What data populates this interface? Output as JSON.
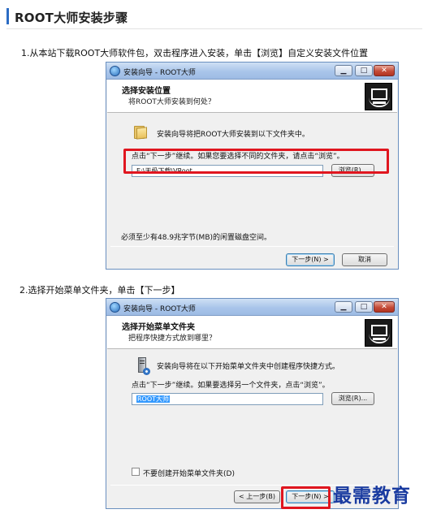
{
  "page": {
    "title": "ROOT大师安装步骤",
    "accent_color": "#2b6cc4",
    "highlight_color": "#e0161f"
  },
  "steps": [
    {
      "text": "1.从本站下载ROOT大师软件包，双击程序进入安装，单击【浏览】自定义安装文件位置",
      "dialog": {
        "window_title": "安装向导 - ROOT大师",
        "header_title": "选择安装位置",
        "header_subtitle": "将ROOT大师安装到何处？",
        "icon": "folder-icon",
        "intro": "安装向导将把ROOT大师安装到以下文件夹中。",
        "instruction": "点击“下一步”继续。如果您要选择不同的文件夹，请点击“浏览”。",
        "path_value": "E:\\天极下载\\VRoot",
        "browse_label": "浏览(R)...",
        "space_note": "必须至少有48.9兆字节(MB)的闲置磁盘空间。",
        "next_label": "下一步(N) >",
        "cancel_label": "取消"
      }
    },
    {
      "text": "2.选择开始菜单文件夹，单击【下一步】",
      "dialog": {
        "window_title": "安装向导 - ROOT大师",
        "header_title": "选择开始菜单文件夹",
        "header_subtitle": "把程序快捷方式放到哪里？",
        "icon": "server-icon",
        "intro": "安装向导将在以下开始菜单文件夹中创建程序快捷方式。",
        "instruction": "点击“下一步”继续。如果要选择另一个文件夹，点击“浏览”。",
        "path_value": "ROOT大师",
        "browse_label": "浏览(R)...",
        "checkbox_label": "不要创建开始菜单文件夹(D)",
        "checkbox_checked": false,
        "back_label": "< 上一步(B)",
        "next_label": "下一步(N) >"
      }
    }
  ],
  "watermark": "最需教育"
}
